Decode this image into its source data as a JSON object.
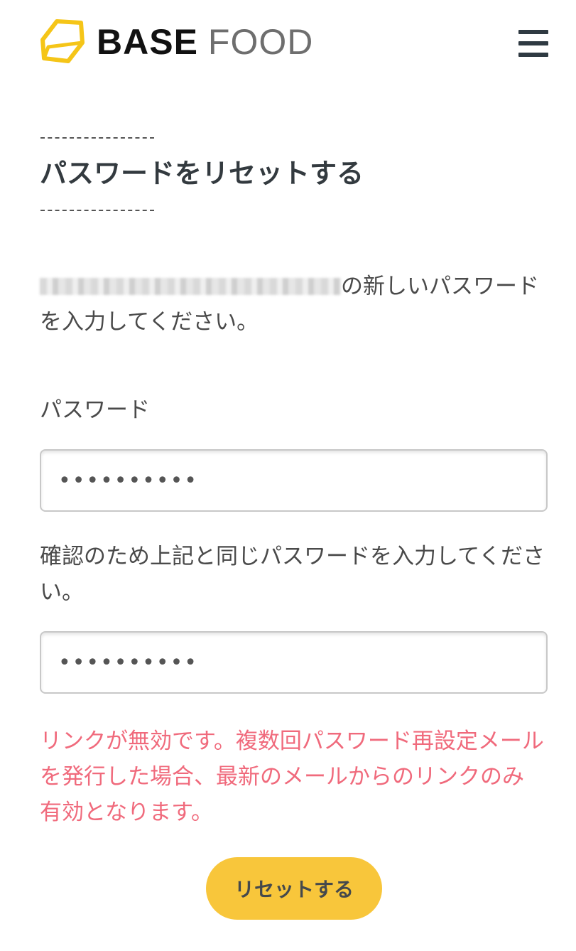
{
  "header": {
    "logo": {
      "icon": "hexagon-logo-icon",
      "brand_bold": "BASE",
      "brand_light": "FOOD",
      "mark_color": "#f5c518"
    },
    "menu_icon": "hamburger-menu-icon"
  },
  "page": {
    "title": "パスワードをリセットする"
  },
  "intro": {
    "email_masked": "(blurred email address)",
    "text_after_email": "の新しいパスワードを入力してください。"
  },
  "form": {
    "password_label": "パスワード",
    "password_value": "••••••••••",
    "confirm_label": "確認のため上記と同じパスワードを入力してください。",
    "confirm_value": "••••••••••"
  },
  "error": {
    "message": "リンクが無効です。複数回パスワード再設定メールを発行した場合、最新のメールからのリンクのみ有効となります。",
    "color": "#f06a7c"
  },
  "actions": {
    "submit_label": "リセットする",
    "submit_color": "#f8c63b"
  }
}
